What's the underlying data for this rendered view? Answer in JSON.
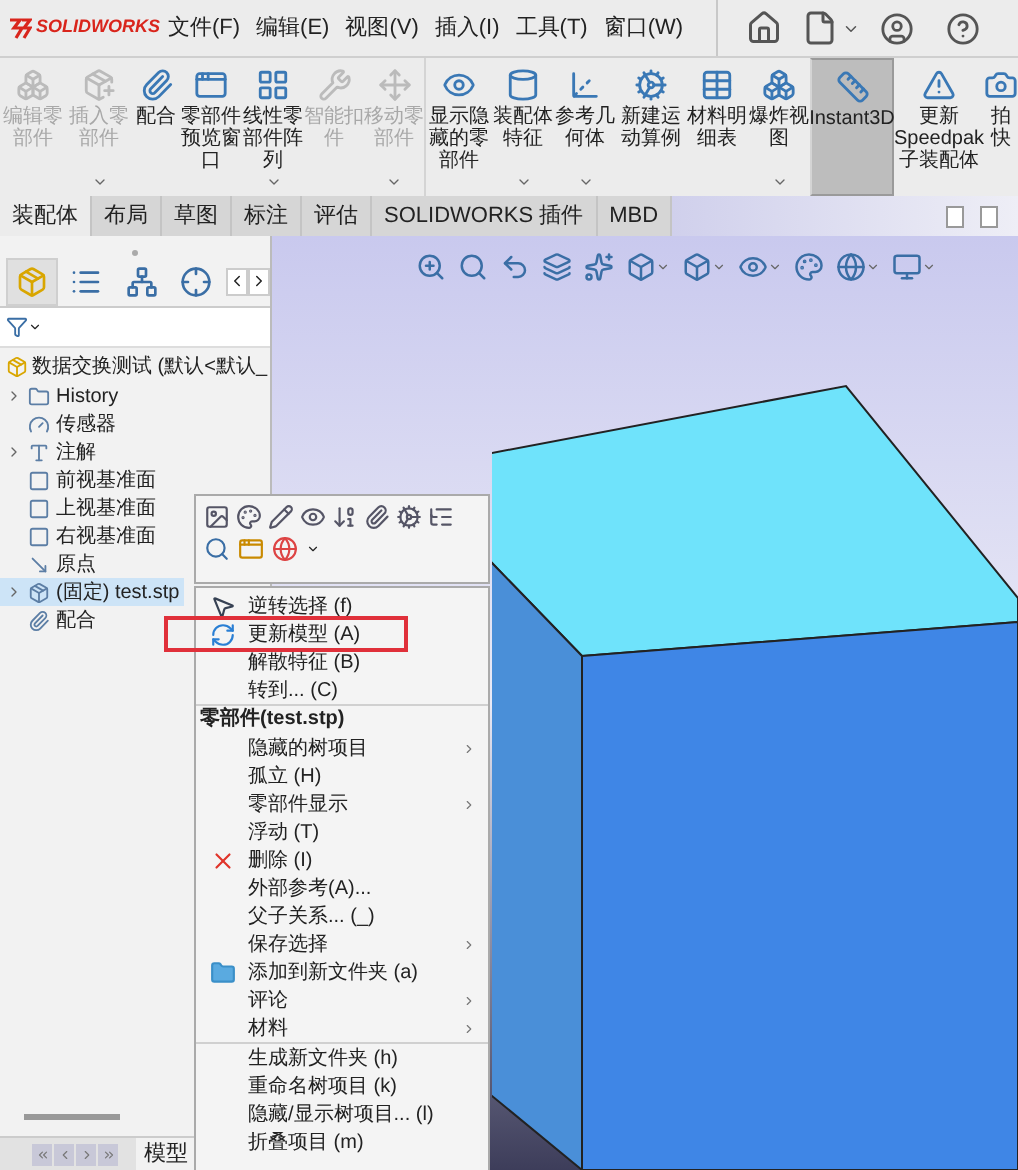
{
  "app": {
    "logo": "SOLIDWORKS"
  },
  "menu_bar": [
    "文件(F)",
    "编辑(E)",
    "视图(V)",
    "插入(I)",
    "工具(T)",
    "窗口(W)"
  ],
  "ribbon": [
    {
      "label": "编辑零部件",
      "disabled": true,
      "dropdown": false,
      "selected": false
    },
    {
      "label": "插入零部件",
      "disabled": true,
      "dropdown": true,
      "selected": false
    },
    {
      "label": "配合",
      "disabled": false,
      "dropdown": false,
      "selected": false
    },
    {
      "label": "零部件预览窗口",
      "disabled": false,
      "dropdown": false,
      "selected": false
    },
    {
      "label": "线性零部件阵列",
      "disabled": false,
      "dropdown": true,
      "selected": false
    },
    {
      "label": "智能扣件",
      "disabled": true,
      "dropdown": false,
      "selected": false
    },
    {
      "label": "移动零部件",
      "disabled": true,
      "dropdown": true,
      "selected": false
    },
    {
      "label": "显示隐藏的零部件",
      "disabled": false,
      "dropdown": false,
      "selected": false
    },
    {
      "label": "装配体特征",
      "disabled": false,
      "dropdown": true,
      "selected": false
    },
    {
      "label": "参考几何体",
      "disabled": false,
      "dropdown": true,
      "selected": false
    },
    {
      "label": "新建运动算例",
      "disabled": false,
      "dropdown": false,
      "selected": false
    },
    {
      "label": "材料明细表",
      "disabled": false,
      "dropdown": false,
      "selected": false
    },
    {
      "label": "爆炸视图",
      "disabled": false,
      "dropdown": true,
      "selected": false
    },
    {
      "label": "Instant3D",
      "disabled": false,
      "dropdown": false,
      "selected": true
    },
    {
      "label": "更新Speedpak子装配体",
      "disabled": false,
      "dropdown": false,
      "selected": false
    },
    {
      "label": "拍快",
      "disabled": false,
      "dropdown": false,
      "selected": false
    }
  ],
  "tabs": [
    {
      "label": "装配体",
      "selected": true
    },
    {
      "label": "布局",
      "selected": false
    },
    {
      "label": "草图",
      "selected": false
    },
    {
      "label": "标注",
      "selected": false
    },
    {
      "label": "评估",
      "selected": false
    },
    {
      "label": "SOLIDWORKS 插件",
      "selected": false
    },
    {
      "label": "MBD",
      "selected": false
    }
  ],
  "panel_tabs": [
    {
      "selected": true
    },
    {
      "selected": false
    },
    {
      "selected": false
    },
    {
      "selected": false
    }
  ],
  "tree": {
    "root": "数据交换测试 (默认<默认_",
    "items": [
      {
        "label": "History",
        "expandable": true,
        "selected": false
      },
      {
        "label": "传感器",
        "expandable": false,
        "selected": false
      },
      {
        "label": "注解",
        "expandable": true,
        "selected": false
      },
      {
        "label": "前视基准面",
        "expandable": false,
        "selected": false
      },
      {
        "label": "上视基准面",
        "expandable": false,
        "selected": false
      },
      {
        "label": "右视基准面",
        "expandable": false,
        "selected": false
      },
      {
        "label": "原点",
        "expandable": false,
        "selected": false
      },
      {
        "label": "(固定) test.stp",
        "expandable": true,
        "selected": true
      },
      {
        "label": "配合",
        "expandable": false,
        "selected": false
      }
    ]
  },
  "context_menu": {
    "groups": [
      {
        "items": [
          {
            "label": "逆转选择 (f)",
            "submenu": false,
            "highlighted": false
          },
          {
            "label": "更新模型 (A)",
            "submenu": false,
            "highlighted": true
          },
          {
            "label": "解散特征 (B)",
            "submenu": false,
            "highlighted": false
          },
          {
            "label": "转到... (C)",
            "submenu": false,
            "highlighted": false
          }
        ]
      },
      {
        "header": "零部件(test.stp)",
        "items": [
          {
            "label": "隐藏的树项目",
            "submenu": true,
            "highlighted": false
          },
          {
            "label": "孤立 (H)",
            "submenu": false,
            "highlighted": false
          },
          {
            "label": "零部件显示",
            "submenu": true,
            "highlighted": false
          },
          {
            "label": "浮动 (T)",
            "submenu": false,
            "highlighted": false
          },
          {
            "label": "删除 (I)",
            "submenu": false,
            "highlighted": false
          },
          {
            "label": "外部参考(A)...",
            "submenu": false,
            "highlighted": false
          },
          {
            "label": "父子关系... (_)",
            "submenu": false,
            "highlighted": false
          },
          {
            "label": "保存选择",
            "submenu": true,
            "highlighted": false
          },
          {
            "label": "添加到新文件夹 (a)",
            "submenu": false,
            "highlighted": false
          },
          {
            "label": "评论",
            "submenu": true,
            "highlighted": false
          },
          {
            "label": "材料",
            "submenu": true,
            "highlighted": false
          }
        ]
      },
      {
        "items": [
          {
            "label": "生成新文件夹 (h)",
            "submenu": false,
            "highlighted": false
          },
          {
            "label": "重命名树项目 (k)",
            "submenu": false,
            "highlighted": false
          },
          {
            "label": "隐藏/显示树项目... (l)",
            "submenu": false,
            "highlighted": false
          },
          {
            "label": "折叠项目 (m)",
            "submenu": false,
            "highlighted": false
          }
        ]
      }
    ]
  },
  "bottom_tab": "模型"
}
